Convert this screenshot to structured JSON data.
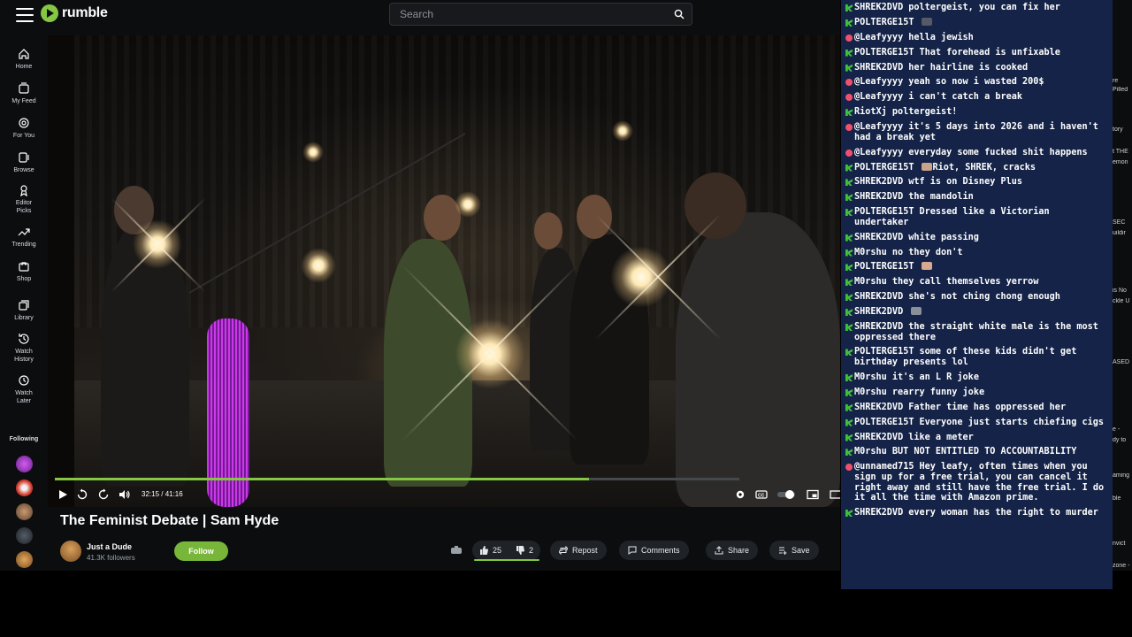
{
  "header": {
    "logo_text": "rumble",
    "search_placeholder": "Search"
  },
  "nav": {
    "items": [
      {
        "label": "Home",
        "icon": "home-icon"
      },
      {
        "label": "My Feed",
        "icon": "feed-icon"
      },
      {
        "label": "For You",
        "icon": "for-you-icon"
      },
      {
        "label": "Browse",
        "icon": "browse-icon"
      },
      {
        "label": "Editor Picks",
        "icon": "editor-picks-icon"
      },
      {
        "label": "Trending",
        "icon": "trending-icon"
      },
      {
        "label": "Shop",
        "icon": "shop-icon"
      },
      {
        "label": "Library",
        "icon": "library-icon"
      },
      {
        "label": "Watch History",
        "icon": "history-icon"
      },
      {
        "label": "Watch Later",
        "icon": "clock-icon"
      }
    ],
    "following_label": "Following"
  },
  "player": {
    "time": "32:15 / 41:16",
    "progress_fraction": 0.78
  },
  "video": {
    "title": "The Feminist Debate | Sam Hyde",
    "channel": "Just a Dude",
    "followers": "41.3K followers",
    "follow_label": "Follow",
    "upvotes": "25",
    "downvotes": "2",
    "repost_label": "Repost",
    "comments_label": "Comments",
    "share_label": "Share",
    "save_label": "Save"
  },
  "chat": [
    {
      "badge": "rumble",
      "user": "SHREK2DVD",
      "text": "poltergeist, you can fix her"
    },
    {
      "badge": "rumble",
      "user": "POLTERGE15T",
      "text": "",
      "emote": "#555a66"
    },
    {
      "badge": "kick",
      "user": "@Leafyyyy",
      "text": "hella jewish"
    },
    {
      "badge": "rumble",
      "user": "POLTERGE15T",
      "text": "That forehead is unfixable"
    },
    {
      "badge": "rumble",
      "user": "SHREK2DVD",
      "text": "her hairline is cooked"
    },
    {
      "badge": "kick",
      "user": "@Leafyyyy",
      "text": "yeah so now i wasted 200$"
    },
    {
      "badge": "kick",
      "user": "@Leafyyyy",
      "text": "i can't catch a break"
    },
    {
      "badge": "rumble",
      "user": "RiotXj",
      "text": "poltergeist!"
    },
    {
      "badge": "kick",
      "user": "@Leafyyyy",
      "text": "it's 5 days into 2026 and i haven't had a break yet"
    },
    {
      "badge": "kick",
      "user": "@Leafyyyy",
      "text": "everyday some fucked shit happens"
    },
    {
      "badge": "rumble",
      "user": "POLTERGE15T",
      "text": "Riot, SHREK, cracks",
      "emote": "#c9a28a"
    },
    {
      "badge": "rumble",
      "user": "SHREK2DVD",
      "text": "wtf is on Disney Plus"
    },
    {
      "badge": "rumble",
      "user": "SHREK2DVD",
      "text": "the mandolin"
    },
    {
      "badge": "rumble",
      "user": "POLTERGE15T",
      "text": "Dressed like a Victorian undertaker"
    },
    {
      "badge": "rumble",
      "user": "SHREK2DVD",
      "text": "white passing"
    },
    {
      "badge": "rumble",
      "user": "M0rshu",
      "text": "no they don't"
    },
    {
      "badge": "rumble",
      "user": "POLTERGE15T",
      "text": "",
      "emote": "#d9a98f"
    },
    {
      "badge": "rumble",
      "user": "M0rshu",
      "text": "they call themselves yerrow"
    },
    {
      "badge": "rumble",
      "user": "SHREK2DVD",
      "text": "she's not ching chong enough"
    },
    {
      "badge": "rumble",
      "user": "SHREK2DVD",
      "text": "",
      "emote": "#8a8f99"
    },
    {
      "badge": "rumble",
      "user": "SHREK2DVD",
      "text": "the straight white male is the most oppressed there"
    },
    {
      "badge": "rumble",
      "user": "POLTERGE15T",
      "text": "some of these kids didn't get birthday presents lol"
    },
    {
      "badge": "rumble",
      "user": "M0rshu",
      "text": "it's an L R joke"
    },
    {
      "badge": "rumble",
      "user": "M0rshu",
      "text": "rearry funny joke"
    },
    {
      "badge": "rumble",
      "user": "SHREK2DVD",
      "text": "Father time has oppressed her"
    },
    {
      "badge": "rumble",
      "user": "POLTERGE15T",
      "text": "Everyone just starts chiefing cigs"
    },
    {
      "badge": "rumble",
      "user": "SHREK2DVD",
      "text": "like a meter"
    },
    {
      "badge": "rumble",
      "user": "M0rshu",
      "text": "BUT NOT ENTITLED TO ACCOUNTABILITY"
    },
    {
      "badge": "kick",
      "user": "@unnamed715",
      "text": "Hey leafy, often times when you sign up for a free trial, you can cancel it right away and still have the free trial. I do it all the time with Amazon prime."
    },
    {
      "badge": "rumble",
      "user": "SHREK2DVD",
      "text": "every woman has the right to murder"
    }
  ],
  "right_strip": [
    "re",
    "Pilled",
    "tory",
    "t THE",
    "emon",
    "SEC",
    "uildir",
    "is No",
    "ckle U",
    "ASED",
    "e -",
    "dy to",
    "aming",
    "ble",
    "nvict",
    "zone -"
  ],
  "colors": {
    "brand_green": "#85c742",
    "chat_bg": "#142347",
    "page_bg": "#0b0d0f"
  }
}
